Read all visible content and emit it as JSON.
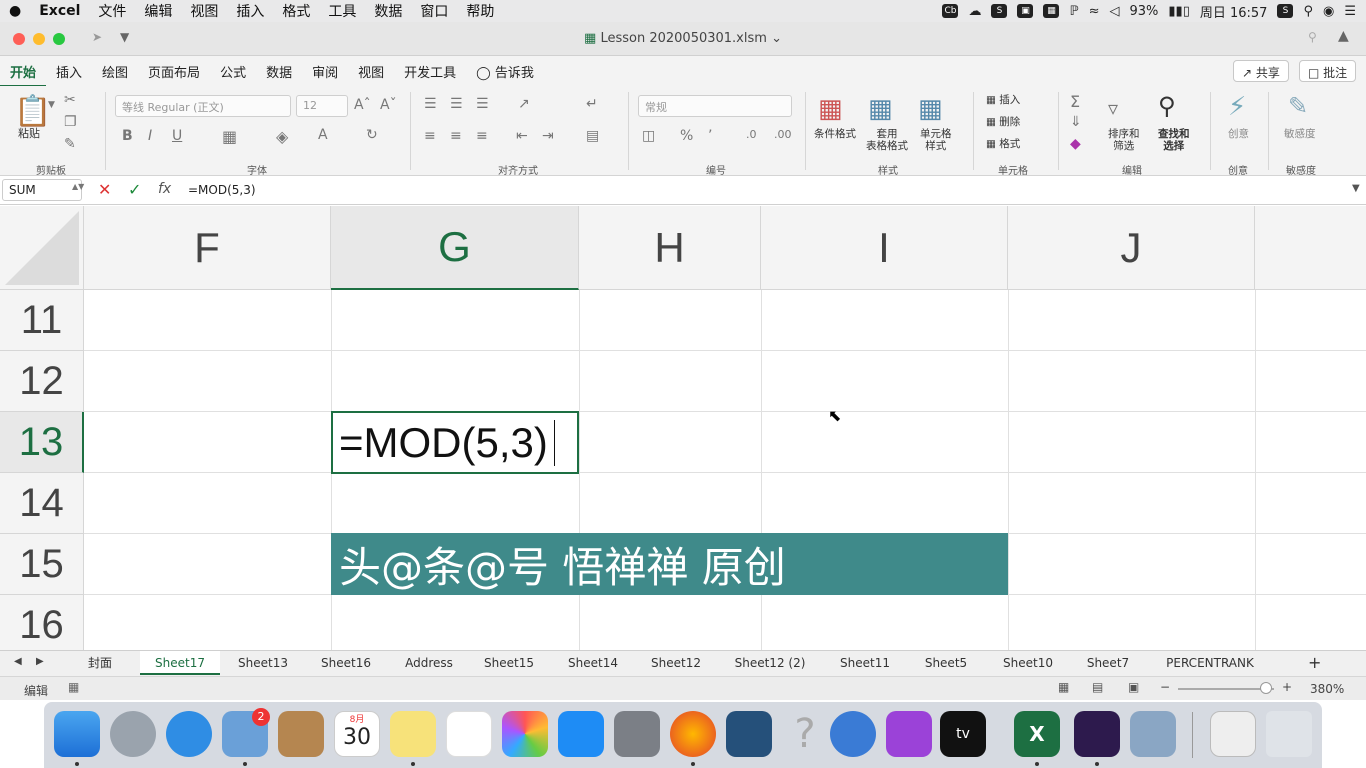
{
  "menubar": {
    "apple": "",
    "app": "Excel",
    "items": [
      "文件",
      "编辑",
      "视图",
      "插入",
      "格式",
      "工具",
      "数据",
      "窗口",
      "帮助"
    ],
    "battery": "93%",
    "clock": "周日 16:57"
  },
  "window": {
    "title": "Lesson 2020050301.xlsm"
  },
  "ribbon": {
    "tabs": [
      "开始",
      "插入",
      "绘图",
      "页面布局",
      "公式",
      "数据",
      "审阅",
      "视图",
      "开发工具",
      "告诉我"
    ],
    "share": "共享",
    "comments": "批注",
    "paste": "粘贴",
    "font_name": "等线 Regular (正文)",
    "font_size": "12",
    "number_format": "常规",
    "cond_format": "条件格式",
    "table_format": [
      "套用",
      "表格格式"
    ],
    "cell_style": [
      "单元格",
      "样式"
    ],
    "insert": "插入",
    "delete": "删除",
    "format": "格式",
    "sort_filter": [
      "排序和",
      "筛选"
    ],
    "find_select": [
      "查找和",
      "选择"
    ],
    "ideas": "创意",
    "sensitivity": "敏感度",
    "groups": {
      "clipboard": "剪贴板",
      "font": "字体",
      "alignment": "对齐方式",
      "number": "编号",
      "styles": "样式",
      "cells": "单元格",
      "editing": "编辑",
      "ideas": "创意",
      "sensitivity": "敏感度"
    }
  },
  "formula_bar": {
    "name_box": "SUM",
    "fx": "fx",
    "formula": "=MOD(5,3)"
  },
  "grid": {
    "columns": [
      "F",
      "G",
      "H",
      "I",
      "J"
    ],
    "rows": [
      "11",
      "12",
      "13",
      "14",
      "15",
      "16"
    ],
    "active_cell_text": "=MOD(5,3)",
    "banner_text": "头@条@号 悟禅禅 原创"
  },
  "sheets": [
    "封面",
    "Sheet17",
    "Sheet13",
    "Sheet16",
    "Address",
    "Sheet15",
    "Sheet14",
    "Sheet12",
    "Sheet12 (2)",
    "Sheet11",
    "Sheet5",
    "Sheet10",
    "Sheet7",
    "PERCENTRANK"
  ],
  "status": {
    "mode": "编辑",
    "zoom": "380%"
  },
  "dock": {
    "calendar_month": "8月",
    "calendar_day": "30",
    "mail_badge": "2"
  }
}
